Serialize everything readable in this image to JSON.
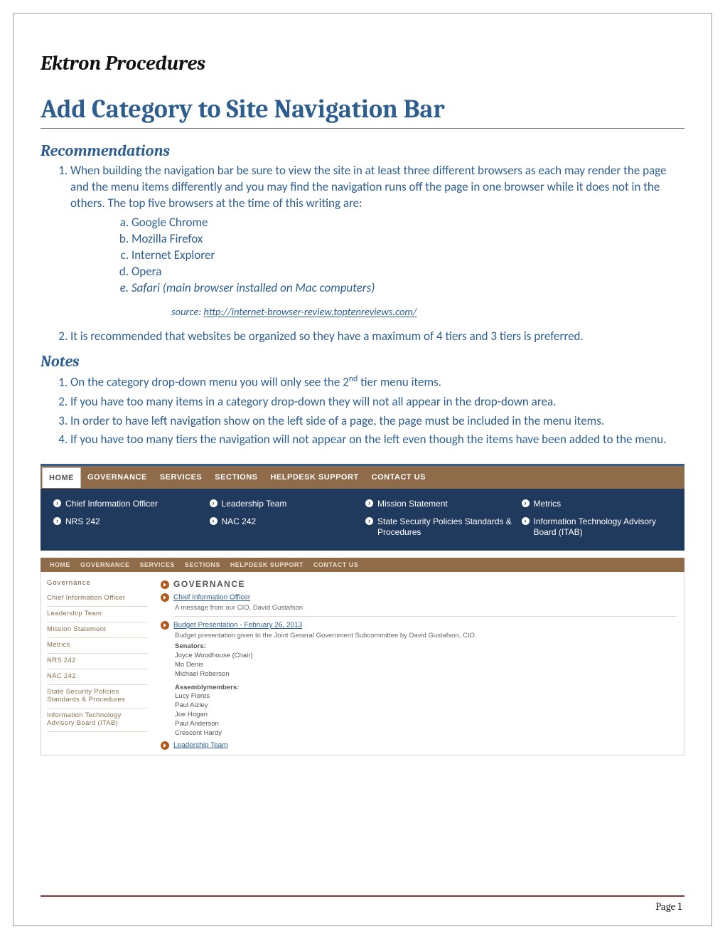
{
  "doc": {
    "supertitle": "Ektron Procedures",
    "title": "Add Category to Site Navigation Bar",
    "sections": {
      "recommendations": "Recommendations",
      "notes": "Notes"
    }
  },
  "recs": {
    "r1": "When building the navigation bar be sure to view the site in at least three different browsers as each may render the page and the menu items differently and you may find the navigation runs off the page in one browser while it does not in the others.  The top five browsers at the time of this writing are:",
    "browsers": {
      "a": "Google Chrome",
      "b": "Mozilla Firefox",
      "c": "Internet Explorer",
      "d": "Opera",
      "e": "Safari (main browser installed on Mac computers)"
    },
    "source_label": "source: ",
    "source_url": "http://internet-browser-review.toptenreviews.com/",
    "r2": "It is recommended that websites be organized so they have a maximum of 4 tiers and 3 tiers is preferred."
  },
  "notes": {
    "n1_a": "On the category drop-down menu you will only see the 2",
    "n1_sup": "nd",
    "n1_b": " tier menu items.",
    "n2": "If you have too many items in a category drop-down they will not all appear in the drop-down area.",
    "n3": "In order to have left navigation show on the left side of a page, the page must be included in the menu items.",
    "n4": " If you have too many tiers the navigation will not appear on the left even though the items have been added to the menu."
  },
  "nav": {
    "top": [
      "HOME",
      "GOVERNANCE",
      "SERVICES",
      "SECTIONS",
      "HELPDESK SUPPORT",
      "CONTACT US"
    ],
    "mega": [
      "Chief Information Officer",
      "Leadership Team",
      "Mission Statement",
      "Metrics",
      "NRS 242",
      "NAC 242",
      "State Security Policies Standards & Procedures",
      "Information Technology Advisory Board (ITAB)"
    ]
  },
  "lower": {
    "sidenav_head": "Governance",
    "sidenav": [
      "Chief Information Officer",
      "Leadership Team",
      "Mission Statement",
      "Metrics",
      "NRS 242",
      "NAC 242",
      "State Security Policies Standards & Procedures",
      "Information Technology Advisory Board (ITAB)"
    ],
    "content": {
      "heading": "GOVERNANCE",
      "cio_link": "Chief Information Officer",
      "cio_sub": "A message from our CIO, David Gustafson",
      "budget_link": "Budget Presentation - February 26, 2013",
      "budget_sub": "Budget presentation given to the Joint General Government Subcommittee by David Gustafson, CIO.",
      "senators_label": "Senators:",
      "senators": [
        "Joyce Woodhouse (Chair)",
        "Mo Denis",
        "Michael Roberson"
      ],
      "assembly_label": "Assemblymembers:",
      "assembly": [
        "Lucy Flores",
        "Paul Aizley",
        "Joe Hogan",
        "Paul Anderson",
        "Crescent Hardy"
      ],
      "leadership_link": "Leadership Team"
    }
  },
  "footer": {
    "page": "Page 1"
  }
}
